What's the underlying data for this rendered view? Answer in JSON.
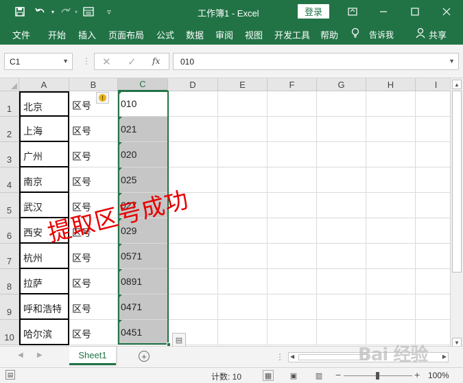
{
  "window": {
    "title": "工作簿1  -  Excel",
    "login_label": "登录",
    "icons": [
      "save-icon",
      "undo-icon",
      "redo-icon",
      "form-icon",
      "customize-icon",
      "ribbon-display-icon",
      "minimize-icon",
      "maximize-icon",
      "close-icon"
    ]
  },
  "ribbon": {
    "tabs": [
      "文件",
      "开始",
      "插入",
      "页面布局",
      "公式",
      "数据",
      "审阅",
      "视图",
      "开发工具",
      "帮助"
    ],
    "tell_me": "告诉我",
    "share": "共享"
  },
  "formula_bar": {
    "name_box": "C1",
    "fx": "fx",
    "formula": "010"
  },
  "grid": {
    "columns": [
      "A",
      "B",
      "C",
      "D",
      "E",
      "F",
      "G",
      "H",
      "I"
    ],
    "rows": [
      "1",
      "2",
      "3",
      "4",
      "5",
      "6",
      "7",
      "8",
      "9",
      "10"
    ],
    "col_a": [
      "北京",
      "上海",
      "广州",
      "南京",
      "武汉",
      "西安",
      "杭州",
      "拉萨",
      "呼和浩特",
      "哈尔滨"
    ],
    "col_b": [
      "区号",
      "区号",
      "区号",
      "区号",
      "区号",
      "区号",
      "区号",
      "区号",
      "区号",
      "区号"
    ],
    "col_c": [
      "010",
      "021",
      "020",
      "025",
      "027",
      "029",
      "0571",
      "0891",
      "0471",
      "0451"
    ],
    "overlay_text": "提取区号成功",
    "selection_color": "#217346"
  },
  "sheets": {
    "tabs": [
      "Sheet1"
    ]
  },
  "status": {
    "count": "计数: 10",
    "zoom": "100%"
  },
  "watermark": "Bai 经验",
  "colors": {
    "brand": "#217346",
    "overlay": "#e60000"
  }
}
